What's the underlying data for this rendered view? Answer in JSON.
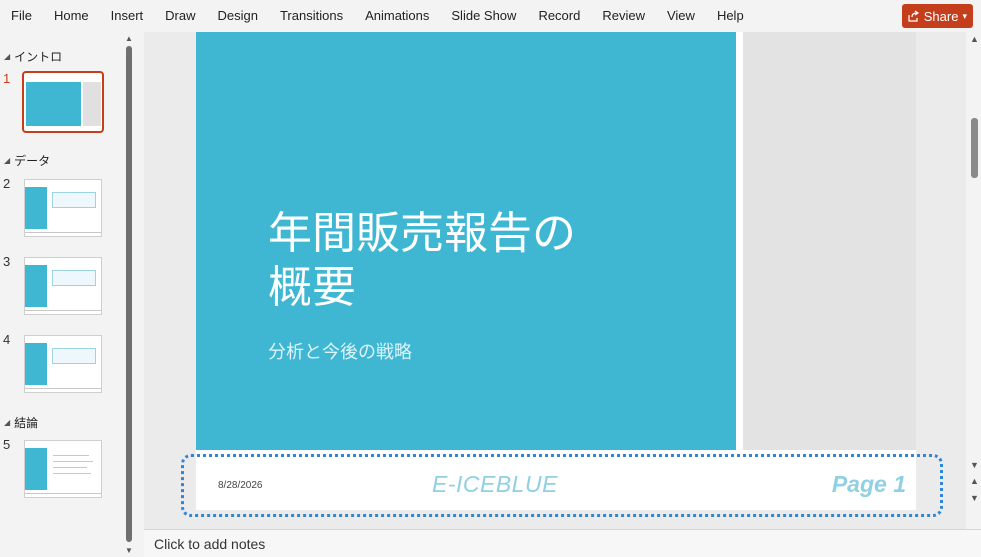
{
  "menu": {
    "items": [
      "File",
      "Home",
      "Insert",
      "Draw",
      "Design",
      "Transitions",
      "Animations",
      "Slide Show",
      "Record",
      "Review",
      "View",
      "Help"
    ],
    "share_label": "Share"
  },
  "thumbnails": {
    "sections": [
      {
        "name": "イントロ"
      },
      {
        "name": "データ"
      },
      {
        "name": "結論"
      }
    ],
    "slides": [
      {
        "number": "1"
      },
      {
        "number": "2"
      },
      {
        "number": "3"
      },
      {
        "number": "4"
      },
      {
        "number": "5"
      }
    ]
  },
  "slide": {
    "title_line1": "年間販売報告の",
    "title_line2": "概要",
    "subtitle": "分析と今後の戦略",
    "date": "8/28/2026",
    "footer_brand": "E-ICEBLUE",
    "page_number": "Page 1"
  },
  "notes": {
    "placeholder": "Click to add notes"
  },
  "colors": {
    "accent": "#c43e1c",
    "slide_blue": "#3fb7d3",
    "highlight": "#2f86d6",
    "footer_text": "#8fd0e2"
  }
}
